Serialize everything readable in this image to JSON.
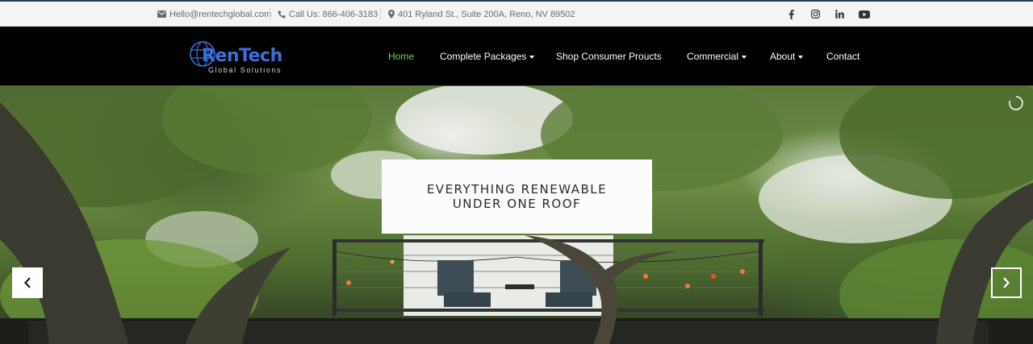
{
  "topbar": {
    "email": "Hello@rentechglobal.com",
    "phone": "Call Us: 866-406-3183",
    "address": "401 Ryland St., Suite 200A, Reno, NV 89502",
    "social_icons": [
      "facebook-icon",
      "instagram-icon",
      "linkedin-icon",
      "youtube-icon"
    ]
  },
  "logo": {
    "name": "RenTech",
    "tagline": "Global Solutions"
  },
  "nav": {
    "items": [
      {
        "label": "Home",
        "active": true,
        "dropdown": false
      },
      {
        "label": "Complete Packages",
        "active": false,
        "dropdown": true
      },
      {
        "label": "Shop Consumer Proucts",
        "active": false,
        "dropdown": false
      },
      {
        "label": "Commercial",
        "active": false,
        "dropdown": true
      },
      {
        "label": "About",
        "active": false,
        "dropdown": true
      },
      {
        "label": "Contact",
        "active": false,
        "dropdown": false
      }
    ]
  },
  "hero": {
    "caption_line1": "EVERYTHING RENEWABLE",
    "caption_line2": "UNDER ONE ROOF",
    "prev_icon": "chevron-left-icon",
    "next_icon": "chevron-right-icon"
  },
  "colors": {
    "active_nav": "#7dcc4f",
    "header_bg": "#000000",
    "topbar_bg": "#f4f4f2",
    "logo_blue": "#3a6fd8"
  }
}
